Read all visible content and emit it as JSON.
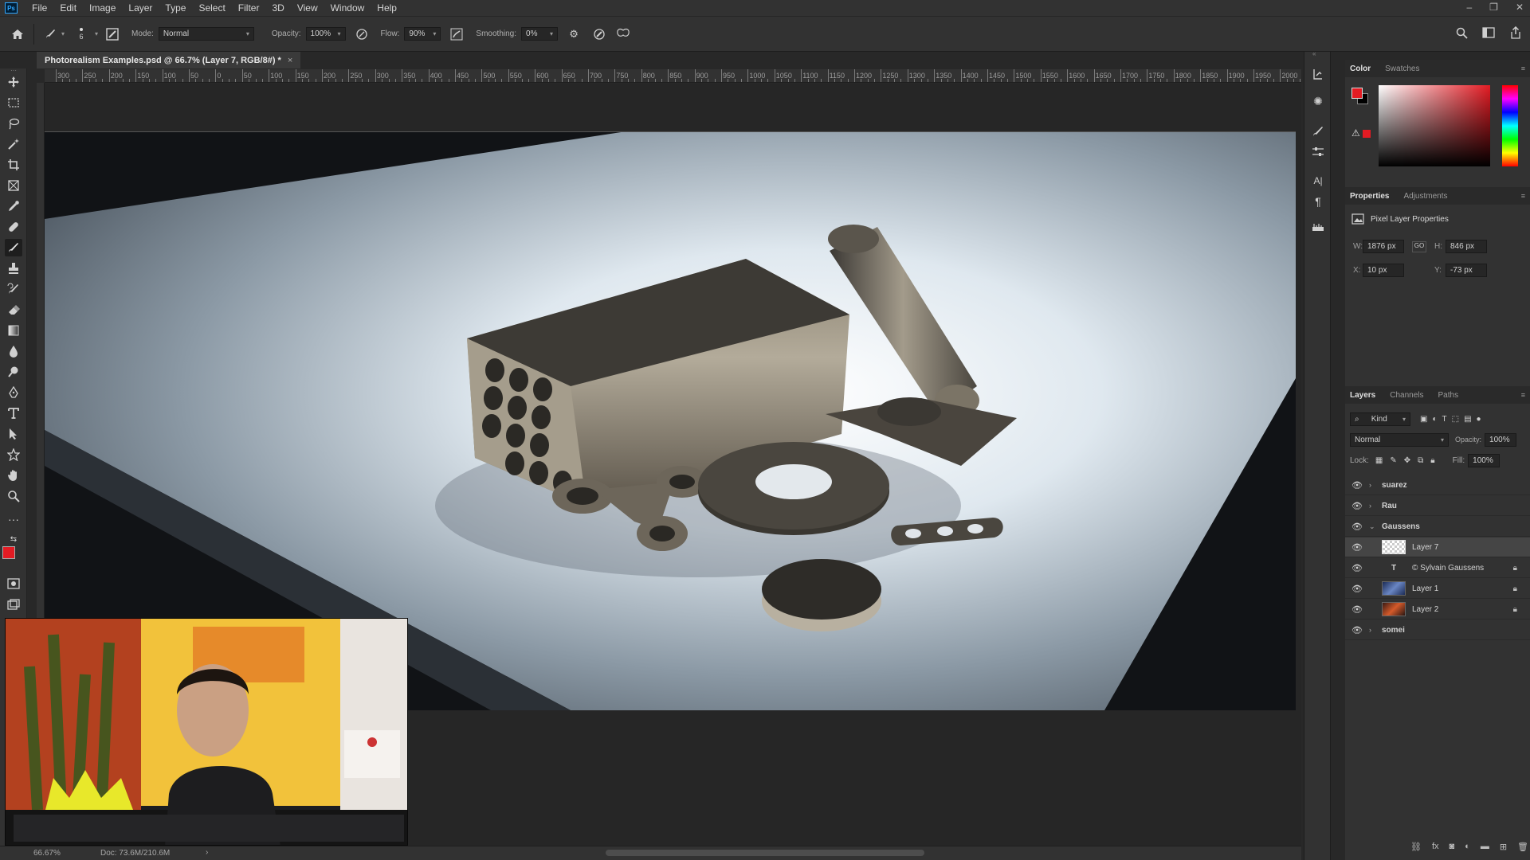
{
  "app": {
    "logo": "Ps"
  },
  "menu": [
    "File",
    "Edit",
    "Image",
    "Layer",
    "Type",
    "Select",
    "Filter",
    "3D",
    "View",
    "Window",
    "Help"
  ],
  "window_controls": [
    "–",
    "❐",
    "✕"
  ],
  "options": {
    "brush_size": "6",
    "mode_label": "Mode:",
    "mode_value": "Normal",
    "opacity_label": "Opacity:",
    "opacity_value": "100%",
    "flow_label": "Flow:",
    "flow_value": "90%",
    "smoothing_label": "Smoothing:",
    "smoothing_value": "0%"
  },
  "document_tab": {
    "title": "Photorealism Examples.psd @ 66.7% (Layer 7, RGB/8#) *",
    "close": "×"
  },
  "ruler_labels": [
    "300",
    "250",
    "200",
    "150",
    "100",
    "50",
    "0",
    "50",
    "100",
    "150",
    "200",
    "250",
    "300",
    "350",
    "400",
    "450",
    "500",
    "550",
    "600",
    "650",
    "700",
    "750",
    "800",
    "850",
    "900",
    "950",
    "1000",
    "1050",
    "1100",
    "1150",
    "1200",
    "1250",
    "1300",
    "1350",
    "1400",
    "1450",
    "1500",
    "1550",
    "1600",
    "1650",
    "1700",
    "1750",
    "1800",
    "1850",
    "1900",
    "1950",
    "2000"
  ],
  "status": {
    "zoom": "66.67%",
    "doc": "Doc: 73.6M/210.6M",
    "arrow": "›"
  },
  "color_panel": {
    "tabs": [
      "Color",
      "Swatches"
    ],
    "foreground": "#e31b23",
    "background": "#000000",
    "hue_color": "#e31b23"
  },
  "properties_panel": {
    "tabs": [
      "Properties",
      "Adjustments"
    ],
    "title": "Pixel Layer Properties",
    "w_label": "W:",
    "w_value": "1876 px",
    "h_label": "H:",
    "h_value": "846 px",
    "x_label": "X:",
    "x_value": "10 px",
    "y_label": "Y:",
    "y_value": "-73 px",
    "link": "GO"
  },
  "layers_panel": {
    "tabs": [
      "Layers",
      "Channels",
      "Paths"
    ],
    "filter": "Kind",
    "blend_mode": "Normal",
    "opacity_label": "Opacity:",
    "opacity_value": "100%",
    "lock_label": "Lock:",
    "fill_label": "Fill:",
    "fill_value": "100%",
    "layers": [
      {
        "name": "suarez",
        "type": "group",
        "expanded": false
      },
      {
        "name": "Rau",
        "type": "group",
        "expanded": false
      },
      {
        "name": "Gaussens",
        "type": "group",
        "expanded": true
      },
      {
        "name": "Layer 7",
        "type": "pixel",
        "selected": true
      },
      {
        "name": "© Sylvain Gaussens",
        "type": "text",
        "locked": true
      },
      {
        "name": "Layer 1",
        "type": "pixel",
        "locked": true
      },
      {
        "name": "Layer 2",
        "type": "pixel",
        "locked": true
      },
      {
        "name": "somei",
        "type": "group",
        "expanded": false
      }
    ]
  },
  "colors": {
    "accent": "#31a8ff",
    "panel_bg": "#323232",
    "canvas_bg": "#262626",
    "selected_row": "#454545"
  }
}
